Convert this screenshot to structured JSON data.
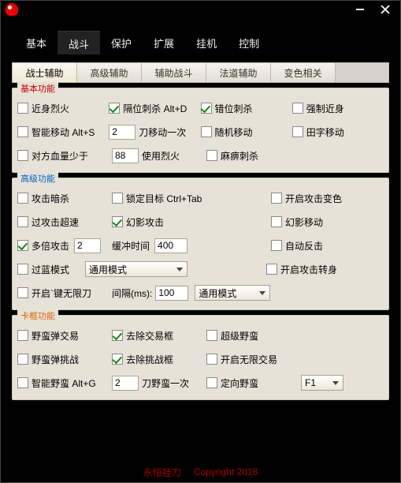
{
  "titlebar": {
    "min_tip": "Min",
    "close_tip": "Close"
  },
  "mainnav": {
    "items": [
      {
        "label": "基本"
      },
      {
        "label": "战斗"
      },
      {
        "label": "保护"
      },
      {
        "label": "扩展"
      },
      {
        "label": "挂机"
      },
      {
        "label": "控制"
      }
    ],
    "active_index": 1
  },
  "subtabs": {
    "items": [
      {
        "label": "战士辅助"
      },
      {
        "label": "高级辅助"
      },
      {
        "label": "辅助战斗"
      },
      {
        "label": "法道辅助"
      },
      {
        "label": "变色相关"
      }
    ],
    "active_index": 0
  },
  "sections": {
    "basic": {
      "title": "基本功能",
      "near_fire": {
        "label": "近身烈火",
        "checked": false
      },
      "gap_stab": {
        "label": "隔位刺杀 Alt+D",
        "checked": true
      },
      "wrong_stab": {
        "label": "错位刺杀",
        "checked": true
      },
      "force_melee": {
        "label": "强制近身",
        "checked": false
      },
      "smart_move": {
        "label": "智能移动 Alt+S",
        "checked": false
      },
      "sword_count": {
        "value": "2",
        "after": "刀移动一次"
      },
      "random_move": {
        "label": "随机移动",
        "checked": false
      },
      "tian_move": {
        "label": "田字移动",
        "checked": false
      },
      "opp_hp": {
        "label": "对方血量少于",
        "checked": false,
        "value": "88",
        "after": "使用烈火"
      },
      "paralyze": {
        "label": "麻痹刺杀",
        "checked": false
      }
    },
    "advanced": {
      "title": "高级功能",
      "attack_kill": {
        "label": "攻击暗杀",
        "checked": false
      },
      "lock_target": {
        "label": "锁定目标 Ctrl+Tab",
        "checked": false
      },
      "open_color": {
        "label": "开启攻击变色",
        "checked": false
      },
      "over_speed": {
        "label": "过攻击超速",
        "checked": false
      },
      "phantom_atk": {
        "label": "幻影攻击",
        "checked": true
      },
      "phantom_move": {
        "label": "幻影移动",
        "checked": false
      },
      "multi_atk": {
        "label": "多倍攻击",
        "checked": true,
        "count": "2"
      },
      "buffer": {
        "label": "缓冲时间",
        "value": "400"
      },
      "auto_counter": {
        "label": "自动反击",
        "checked": false
      },
      "over_blue": {
        "label": "过蓝模式",
        "checked": false
      },
      "over_blue_mode": {
        "value": "通用模式"
      },
      "open_turn": {
        "label": "开启攻击转身",
        "checked": false
      },
      "open_inf": {
        "label": "开启`键无限刀",
        "checked": false
      },
      "interval": {
        "label": "间隔(ms):",
        "value": "100"
      },
      "inf_mode": {
        "value": "通用模式"
      }
    },
    "card": {
      "title": "卡框功能",
      "wild_trade": {
        "label": "野蛮弹交易",
        "checked": false
      },
      "remove_trade": {
        "label": "去除交易框",
        "checked": true
      },
      "super_wild": {
        "label": "超级野蛮",
        "checked": false
      },
      "wild_challenge": {
        "label": "野蛮弹挑战",
        "checked": false
      },
      "remove_challenge": {
        "label": "去除挑战框",
        "checked": true
      },
      "open_inf_trade": {
        "label": "开启无限交易",
        "checked": false
      },
      "smart_wild": {
        "label": "智能野蛮 Alt+G",
        "checked": false,
        "count": "2",
        "after": "刀野蛮一次"
      },
      "dir_wild": {
        "label": "定向野蛮",
        "checked": false
      },
      "dir_key": {
        "value": "F1"
      }
    }
  },
  "footer": {
    "brand": "永恒挂刀",
    "copyright": "Copyright 2018"
  }
}
